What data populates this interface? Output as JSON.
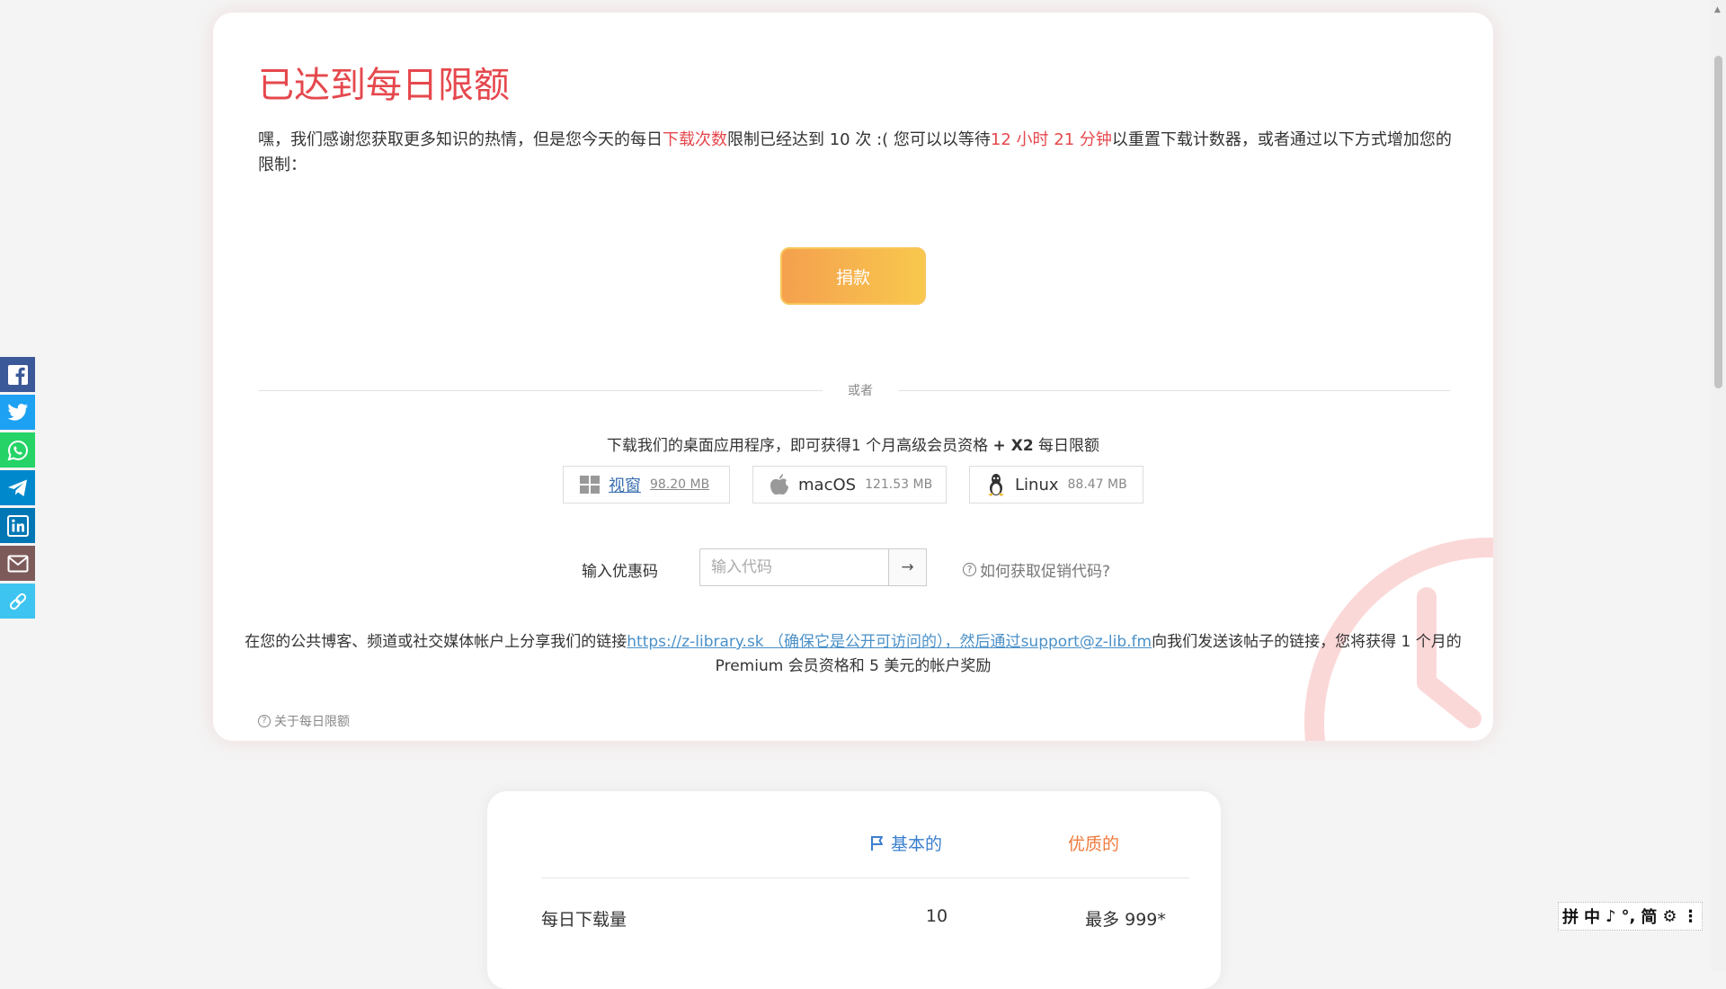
{
  "colors": {
    "title_red": "#e5484d",
    "donate_gradient_start": "#f5a04e",
    "donate_gradient_end": "#f8c84d",
    "link_blue": "#4a90c8",
    "basic_blue": "#3a7fcf",
    "premium_orange": "#f07a3a",
    "clock_pink": "#fbd8d8"
  },
  "limit": {
    "title": "已达到每日限额",
    "msg_part1": "嘿，我们感谢您获取更多知识的热情，但是您今天的每日",
    "msg_highlight1": "下载次数",
    "msg_part2": "限制已经达到 10 次 :( 您可以以等待",
    "msg_highlight2": "12 小时 21 分钟",
    "msg_part3": "以重置下载计数器，或者通过以下方式增加您的限制："
  },
  "donate_label": "捐款",
  "divider_text": "或者",
  "apps": {
    "title_part1": "下载我们的桌面应用程序，即可获得1 个月高级会员资格 ",
    "title_bold": "+ X2",
    "title_part2": " 每日限额",
    "items": [
      {
        "icon": "windows-icon",
        "name": "视窗",
        "size": "98.20 MB"
      },
      {
        "icon": "apple-icon",
        "name": "macOS",
        "size": "121.53 MB"
      },
      {
        "icon": "linux-icon",
        "name": "Linux",
        "size": "88.47 MB"
      }
    ]
  },
  "promo": {
    "label": "输入优惠码",
    "placeholder": "输入代码",
    "submit_arrow": "→",
    "help_text": "如何获取促销代码?"
  },
  "share": {
    "text_part1": "在您的公共博客、频道或社交媒体帐户上分享我们的链接",
    "link_text": "https://z-library.sk （确保它是公开可访问的），然后通过",
    "email_link": "support@z-lib.fm",
    "text_part2": "向我们发送该帖子的链接，您将获得 1 个月的 Premium 会员资格和 5 美元的帐户奖励"
  },
  "about_link": "关于每日限额",
  "social_sidebar": [
    {
      "icon": "facebook-icon",
      "color": "#3b5998"
    },
    {
      "icon": "twitter-icon",
      "color": "#1da1f2"
    },
    {
      "icon": "whatsapp-icon",
      "color": "#25d366"
    },
    {
      "icon": "telegram-icon",
      "color": "#0088cc"
    },
    {
      "icon": "linkedin-icon",
      "color": "#0077b5"
    },
    {
      "icon": "email-icon",
      "color": "#7d5a5a"
    },
    {
      "icon": "link-icon",
      "color": "#3dc4f0"
    }
  ],
  "compare": {
    "basic_label": "基本的",
    "premium_label": "优质的",
    "rows": [
      {
        "label": "每日下载量",
        "basic": "10",
        "premium": "最多 999*"
      }
    ]
  },
  "ime_toolbar": [
    "拼",
    "中",
    "♪",
    "°,",
    "简",
    "⚙",
    "⋮"
  ]
}
